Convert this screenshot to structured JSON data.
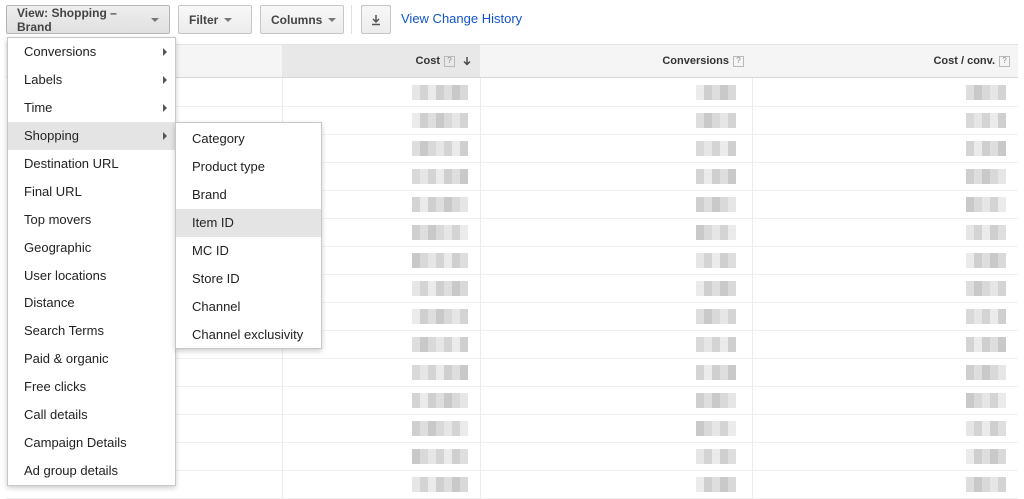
{
  "toolbar": {
    "view_label": "View: Shopping – Brand",
    "filter_label": "Filter",
    "columns_label": "Columns",
    "change_history_link": "View Change History",
    "download_icon": "download-icon"
  },
  "table": {
    "columns": [
      {
        "label": "Cost",
        "help": "?",
        "sorted": true
      },
      {
        "label": "Conversions",
        "help": "?"
      },
      {
        "label": "Cost / conv.",
        "help": "?"
      }
    ],
    "rows_note": "values pixelated"
  },
  "view_menu": {
    "items": [
      {
        "label": "Conversions",
        "submenu": true
      },
      {
        "label": "Labels",
        "submenu": true
      },
      {
        "label": "Time",
        "submenu": true
      },
      {
        "label": "Shopping",
        "submenu": true,
        "highlighted": true
      },
      {
        "label": "Destination URL"
      },
      {
        "label": "Final URL"
      },
      {
        "label": "Top movers"
      },
      {
        "label": "Geographic"
      },
      {
        "label": "User locations"
      },
      {
        "label": "Distance"
      },
      {
        "label": "Search Terms"
      },
      {
        "label": "Paid & organic"
      },
      {
        "label": "Free clicks"
      },
      {
        "label": "Call details"
      },
      {
        "label": "Campaign Details"
      },
      {
        "label": "Ad group details"
      }
    ]
  },
  "shopping_submenu": {
    "items": [
      {
        "label": "Category"
      },
      {
        "label": "Product type"
      },
      {
        "label": "Brand"
      },
      {
        "label": "Item ID",
        "highlighted": true
      },
      {
        "label": "MC ID"
      },
      {
        "label": "Store ID"
      },
      {
        "label": "Channel"
      },
      {
        "label": "Channel exclusivity"
      }
    ]
  }
}
